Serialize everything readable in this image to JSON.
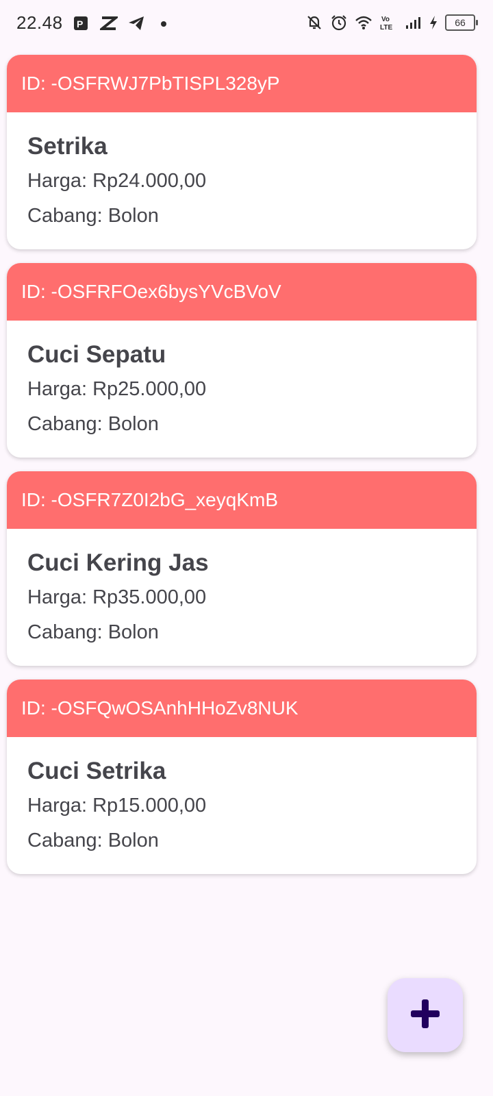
{
  "status_bar": {
    "time": "22.48",
    "battery": "66",
    "icons": [
      "parking-app-icon",
      "capcut-icon",
      "telegram-icon",
      "notification-dot-icon",
      "bell-off-icon",
      "alarm-icon",
      "wifi-icon",
      "volte-icon",
      "signal-icon",
      "charging-icon",
      "battery-icon"
    ]
  },
  "services": [
    {
      "id_label": "ID: -OSFRWJ7PbTISPL328yP",
      "name": "Setrika",
      "price": "Harga: Rp24.000,00",
      "branch": "Cabang: Bolon"
    },
    {
      "id_label": "ID: -OSFRFOex6bysYVcBVoV",
      "name": "Cuci Sepatu",
      "price": "Harga: Rp25.000,00",
      "branch": "Cabang: Bolon"
    },
    {
      "id_label": "ID: -OSFR7Z0I2bG_xeyqKmB",
      "name": "Cuci Kering Jas",
      "price": "Harga: Rp35.000,00",
      "branch": "Cabang: Bolon"
    },
    {
      "id_label": "ID: -OSFQwOSAnhHHoZv8NUK",
      "name": "Cuci Setrika",
      "price": "Harga: Rp15.000,00",
      "branch": "Cabang: Bolon"
    }
  ],
  "fab": {
    "icon": "plus-icon"
  },
  "colors": {
    "header": "#ff6e6e",
    "fab_bg": "#eadcff",
    "fab_icon": "#21005d",
    "background": "#fdf7fd"
  }
}
